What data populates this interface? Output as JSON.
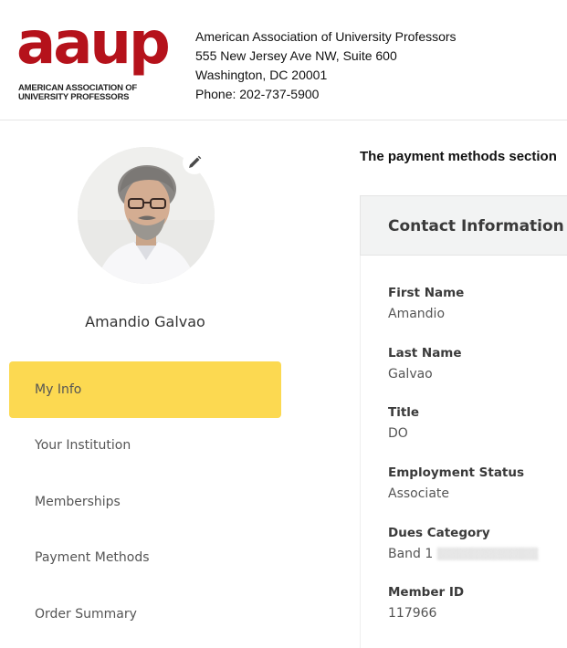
{
  "header": {
    "logo": {
      "word": "aaup",
      "subtitle_line1": "AMERICAN ASSOCIATION OF",
      "subtitle_line2": "UNIVERSITY PROFESSORS"
    },
    "address": [
      "American Association of University Professors",
      "555 New Jersey Ave NW, Suite 600",
      "Washington, DC 20001",
      "Phone: 202-737-5900"
    ]
  },
  "profile": {
    "name": "Amandio Galvao",
    "edit_icon": "pencil-icon"
  },
  "nav": {
    "items": [
      {
        "label": "My Info",
        "active": true
      },
      {
        "label": "Your Institution",
        "active": false
      },
      {
        "label": "Memberships",
        "active": false
      },
      {
        "label": "Payment Methods",
        "active": false
      },
      {
        "label": "Order Summary",
        "active": false
      }
    ]
  },
  "main": {
    "notice": "The payment methods section",
    "card": {
      "title": "Contact Information",
      "fields": [
        {
          "label": "First Name",
          "value": "Amandio"
        },
        {
          "label": "Last Name",
          "value": "Galvao"
        },
        {
          "label": "Title",
          "value": "DO"
        },
        {
          "label": "Employment Status",
          "value": "Associate"
        },
        {
          "label": "Dues Category",
          "value": "Band 1"
        },
        {
          "label": "Member ID",
          "value": "117966"
        }
      ]
    }
  },
  "colors": {
    "brand": "#b5121b",
    "nav_active": "#fcd951",
    "card_header_bg": "#f2f3f3"
  }
}
